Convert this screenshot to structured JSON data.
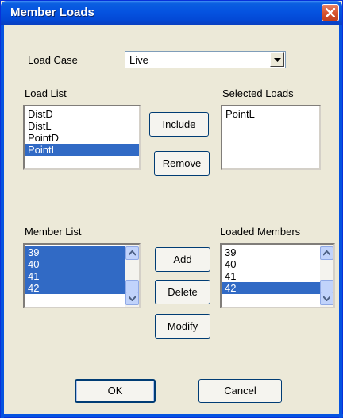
{
  "window": {
    "title": "Member Loads"
  },
  "load_case": {
    "label": "Load Case",
    "value": "Live"
  },
  "load_list": {
    "label": "Load List",
    "items": [
      "DistD",
      "DistL",
      "PointD",
      "PointL"
    ],
    "selected_index": 3
  },
  "selected_loads": {
    "label": "Selected Loads",
    "items": [
      "PointL"
    ]
  },
  "member_list": {
    "label": "Member List",
    "items": [
      "39",
      "40",
      "41",
      "42"
    ],
    "selected": [
      0,
      1,
      2,
      3
    ]
  },
  "loaded_members": {
    "label": "Loaded Members",
    "items": [
      "39",
      "40",
      "41",
      "42"
    ],
    "selected": [
      3
    ]
  },
  "buttons": {
    "include": "Include",
    "remove": "Remove",
    "add": "Add",
    "delete": "Delete",
    "modify": "Modify",
    "ok": "OK",
    "cancel": "Cancel"
  },
  "colors": {
    "selection": "#316ac5",
    "titlebar": "#0553e0",
    "close": "#d8552f",
    "dialog": "#ece9d8"
  }
}
